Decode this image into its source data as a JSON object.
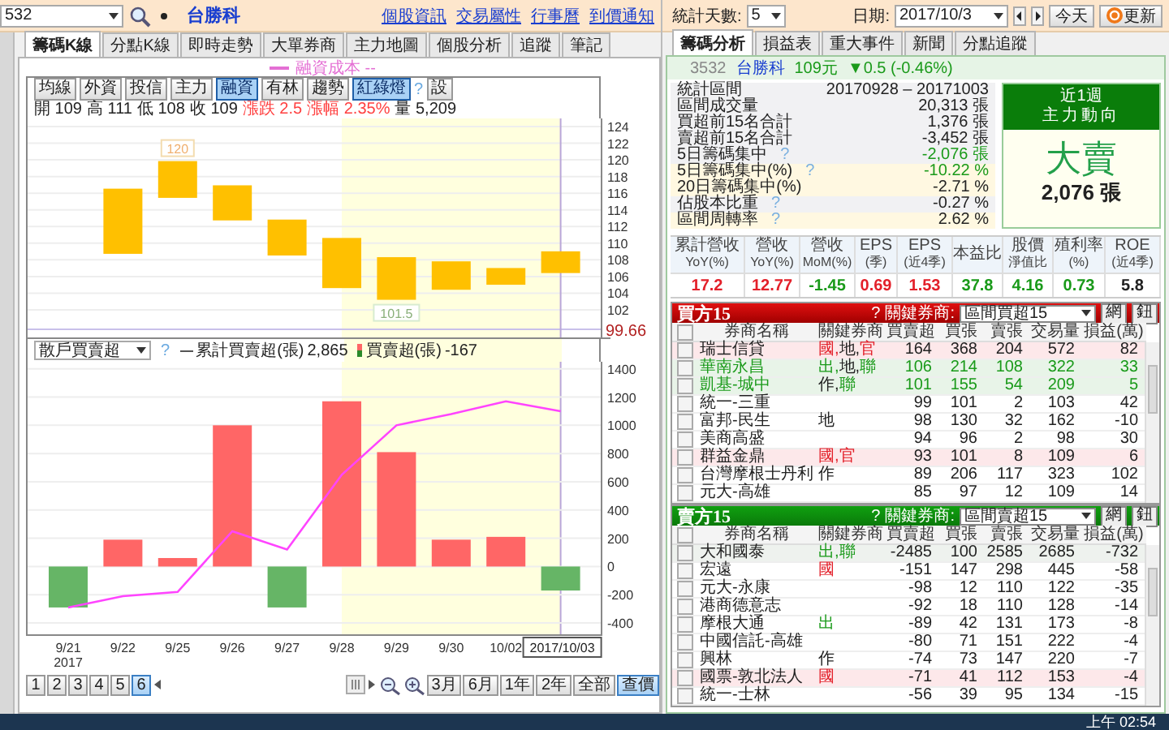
{
  "stock_bar": {
    "code": "532",
    "name": "台勝科",
    "links": [
      "個股資訊",
      "交易屬性",
      "行事曆",
      "到價通知"
    ]
  },
  "left_tabs": [
    {
      "label": "籌碼K線",
      "selected": true
    },
    {
      "label": "分點K線",
      "selected": false
    },
    {
      "label": "即時走勢",
      "selected": false
    },
    {
      "label": "大單券商",
      "selected": false
    },
    {
      "label": "主力地圖",
      "selected": false
    },
    {
      "label": "個股分析",
      "selected": false
    },
    {
      "label": "追蹤",
      "selected": false
    },
    {
      "label": "筆記",
      "selected": false
    }
  ],
  "candle_chart": {
    "legend": "融資成本 --",
    "buttons": [
      {
        "label": "均線",
        "kind": "toggle",
        "selected": false
      },
      {
        "label": "外資",
        "kind": "toggle",
        "selected": false
      },
      {
        "label": "投信",
        "kind": "toggle",
        "selected": false
      },
      {
        "label": "主力",
        "kind": "toggle",
        "selected": false
      },
      {
        "label": "融資",
        "kind": "toggle",
        "selected": true
      },
      {
        "label": "有林",
        "kind": "toggle",
        "selected": false
      },
      {
        "label": "趨勢",
        "kind": "toggle",
        "selected": false
      },
      {
        "label": "紅綠燈",
        "kind": "toggle",
        "selected": true
      },
      {
        "label": "?",
        "kind": "help"
      },
      {
        "label": "設",
        "kind": "toggle",
        "selected": false
      }
    ],
    "quote": [
      {
        "label": "開",
        "value": "109",
        "kind": "plain"
      },
      {
        "label": "高",
        "value": "111",
        "kind": "plain"
      },
      {
        "label": "低",
        "value": "108",
        "kind": "plain"
      },
      {
        "label": "收",
        "value": "109",
        "kind": "plain"
      },
      {
        "label": "漲跌",
        "value": "2.5",
        "kind": "change"
      },
      {
        "label": "漲幅",
        "value": "2.35%",
        "kind": "change"
      },
      {
        "label": "量",
        "value": "5,209",
        "kind": "plain"
      }
    ],
    "price_ticks": [
      "124",
      "122",
      "120",
      "118",
      "116",
      "114",
      "112",
      "110",
      "108",
      "106",
      "104",
      "102"
    ],
    "reference_price": "99.66",
    "high_label": "120",
    "low_label": "101.5"
  },
  "flow_chart": {
    "indicator": "散戶買賣超",
    "help": "?",
    "legend": [
      {
        "kind": "line",
        "value": "2,865"
      },
      {
        "kind": "bars",
        "value": "-167"
      }
    ],
    "year_label": "2017",
    "chart_data": {
      "type": "bar",
      "categories": [
        "9/21",
        "9/22",
        "9/25",
        "9/26",
        "9/27",
        "9/28",
        "9/29",
        "9/30",
        "10/02",
        "2017/10/03"
      ],
      "series": [
        {
          "name": "累計買賣超(張)",
          "type": "line",
          "color": "#ff44ff",
          "values": [
            -290,
            -210,
            -180,
            250,
            120,
            650,
            1000,
            1080,
            1170,
            1100
          ]
        },
        {
          "name": "買賣超(張)",
          "color": "#ff6666",
          "values": [
            -290,
            190,
            60,
            1000,
            -290,
            1170,
            810,
            190,
            210,
            -170
          ],
          "colors": [
            "#66b566",
            "#ff6666",
            "#ff6666",
            "#ff6666",
            "#66b566",
            "#ff6666",
            "#ff6666",
            "#ff6666",
            "#ff6666",
            "#66b566"
          ]
        }
      ],
      "stacked": false,
      "grid": true,
      "ref_lines": [
        {
          "axis": "x",
          "value": "2017/10/03",
          "color": "#b9a6d9"
        }
      ],
      "ylim": [
        -480,
        1450
      ],
      "yticks": [
        -400,
        -200,
        0,
        200,
        400,
        600,
        800,
        1000,
        1200,
        1400
      ]
    }
  },
  "chart_footer": {
    "pages": [
      {
        "label": "1",
        "selected": false
      },
      {
        "label": "2",
        "selected": false
      },
      {
        "label": "3",
        "selected": false
      },
      {
        "label": "4",
        "selected": false
      },
      {
        "label": "5",
        "selected": false
      },
      {
        "label": "6",
        "selected": true
      }
    ],
    "ranges": [
      {
        "label": "3月",
        "selected": false
      },
      {
        "label": "6月",
        "selected": false
      },
      {
        "label": "1年",
        "selected": false
      },
      {
        "label": "2年",
        "selected": false
      },
      {
        "label": "全部",
        "selected": false
      },
      {
        "label": "查價",
        "selected": true
      }
    ]
  },
  "controls": {
    "days_label": "統計天數:",
    "days": "5",
    "date_label": "日期:",
    "date": "2017/10/3",
    "today": "今天",
    "refresh": "更新"
  },
  "right_tabs": [
    {
      "label": "籌碼分析",
      "selected": true
    },
    {
      "label": "損益表",
      "selected": false
    },
    {
      "label": "重大事件",
      "selected": false
    },
    {
      "label": "新聞",
      "selected": false
    },
    {
      "label": "分點追蹤",
      "selected": false
    }
  ],
  "quote_header": {
    "code": "3532",
    "name": "台勝科",
    "price": "109元",
    "change": "▼0.5 (-0.46%)"
  },
  "stats": [
    {
      "label": "統計區間",
      "value": "20170928 – 20171003",
      "kind": "plain"
    },
    {
      "label": "區間成交量",
      "value": "20,313 張",
      "kind": "plain"
    },
    {
      "label": "買超前15名合計",
      "value": "1,376 張",
      "kind": "plain"
    },
    {
      "label": "賣超前15名合計",
      "value": "-3,452 張",
      "kind": "plain"
    },
    {
      "label": "5日籌碼集中",
      "help": "?",
      "value": "-2,076 張",
      "kind": "down"
    },
    {
      "label": "5日籌碼集中(%)",
      "help": "?",
      "value": "-10.22 %",
      "kind": "down"
    },
    {
      "label": "20日籌碼集中(%)",
      "value": "-2.71 %",
      "kind": "plain"
    },
    {
      "label": "佔股本比重",
      "help": "?",
      "value": "-0.27 %",
      "kind": "plain"
    },
    {
      "label": "區間周轉率",
      "help": "?",
      "value": "2.62 %",
      "kind": "plain"
    }
  ],
  "trend_box": {
    "period": "近1週",
    "title": "主力動向",
    "verdict": "大賣",
    "amount": "2,076 張"
  },
  "metrics": [
    {
      "label": "累計營收",
      "sublabel": "YoY(%)",
      "value": "17.2",
      "color": "#e3202a"
    },
    {
      "label": "營收",
      "sublabel": "YoY(%)",
      "value": "12.77",
      "color": "#e3202a"
    },
    {
      "label": "營收",
      "sublabel": "MoM(%)",
      "value": "-1.45",
      "color": "#1a9a1a"
    },
    {
      "label": "EPS",
      "sublabel": "(季)",
      "value": "0.69",
      "color": "#e3202a"
    },
    {
      "label": "EPS",
      "sublabel": "(近4季)",
      "value": "1.53",
      "color": "#e3202a"
    },
    {
      "label": "本益比",
      "value": "37.8",
      "color": "#1a9a1a"
    },
    {
      "label": "股價",
      "sublabel": "淨值比",
      "value": "4.16",
      "color": "#1a9a1a"
    },
    {
      "label": "殖利率",
      "sublabel": "(%)",
      "value": "0.73",
      "color": "#1a9a1a"
    },
    {
      "label": "ROE",
      "sublabel": "(近4季)",
      "value": "5.8",
      "color": "#222222"
    }
  ],
  "tables": [
    {
      "kind": "buy",
      "title": "買方15",
      "help": "?",
      "filter_label": "關鍵券商:",
      "filter": "區間買超15",
      "buttons": [
        "網",
        "鈕"
      ],
      "all_checked": false,
      "columns": [
        "券商名稱",
        "關鍵券商",
        "買賣超",
        "買張",
        "賣張",
        "交易量",
        "損益(萬)"
      ],
      "rows": [
        {
          "checked": false,
          "kind": "red",
          "cells": [
            "瑞士信貸",
            [
              {
                "text": "國,",
                "color": "#e3202a"
              },
              {
                "text": "地,",
                "color": "#222222"
              },
              {
                "text": "官",
                "color": "#e3202a"
              }
            ],
            "164",
            "368",
            "204",
            "572",
            "82"
          ]
        },
        {
          "checked": false,
          "kind": "green",
          "cells": [
            "華南永昌",
            [
              {
                "text": "出,",
                "color": "#1a9a1a"
              },
              {
                "text": "地,",
                "color": "#222222"
              },
              {
                "text": "聯",
                "color": "#1a9a1a"
              }
            ],
            "106",
            "214",
            "108",
            "322",
            "33"
          ]
        },
        {
          "checked": false,
          "kind": "green",
          "cells": [
            "凱基-城中",
            [
              {
                "text": "作,",
                "color": "#222222"
              },
              {
                "text": "聯",
                "color": "#1a9a1a"
              }
            ],
            "101",
            "155",
            "54",
            "209",
            "5"
          ]
        },
        {
          "checked": false,
          "kind": "plain",
          "cells": [
            "統一-三重",
            [],
            "99",
            "101",
            "2",
            "103",
            "42"
          ]
        },
        {
          "checked": false,
          "kind": "plain",
          "cells": [
            "富邦-民生",
            [
              {
                "text": "地",
                "color": "#222222"
              }
            ],
            "98",
            "130",
            "32",
            "162",
            "-10"
          ]
        },
        {
          "checked": false,
          "kind": "plain",
          "cells": [
            "美商高盛",
            [],
            "94",
            "96",
            "2",
            "98",
            "30"
          ]
        },
        {
          "checked": false,
          "kind": "red",
          "cells": [
            "群益金鼎",
            [
              {
                "text": "國,",
                "color": "#e3202a"
              },
              {
                "text": "官",
                "color": "#e3202a"
              }
            ],
            "93",
            "101",
            "8",
            "109",
            "6"
          ]
        },
        {
          "checked": false,
          "kind": "plain",
          "cells": [
            "台灣摩根士丹利",
            [
              {
                "text": "作",
                "color": "#222222"
              }
            ],
            "89",
            "206",
            "117",
            "323",
            "102"
          ]
        },
        {
          "checked": false,
          "kind": "plain",
          "cells": [
            "元大-高雄",
            [],
            "85",
            "97",
            "12",
            "109",
            "14"
          ]
        }
      ]
    },
    {
      "kind": "sell",
      "title": "賣方15",
      "help": "?",
      "filter_label": "關鍵券商:",
      "filter": "區間賣超15",
      "buttons": [
        "網",
        "鈕"
      ],
      "all_checked": false,
      "columns": [
        "券商名稱",
        "關鍵券商",
        "買賣超",
        "買張",
        "賣張",
        "交易量",
        "損益(萬)"
      ],
      "rows": [
        {
          "checked": false,
          "kind": "grey",
          "cells": [
            "大和國泰",
            [
              {
                "text": "出,",
                "color": "#1a9a1a"
              },
              {
                "text": "聯",
                "color": "#1a9a1a"
              }
            ],
            "-2485",
            "100",
            "2585",
            "2685",
            "-732"
          ]
        },
        {
          "checked": false,
          "kind": "plain",
          "cells": [
            "宏遠",
            [
              {
                "text": "國",
                "color": "#e3202a"
              }
            ],
            "-151",
            "147",
            "298",
            "445",
            "-58"
          ]
        },
        {
          "checked": false,
          "kind": "plain",
          "cells": [
            "元大-永康",
            [],
            "-98",
            "12",
            "110",
            "122",
            "-35"
          ]
        },
        {
          "checked": false,
          "kind": "plain",
          "cells": [
            "港商德意志",
            [],
            "-92",
            "18",
            "110",
            "128",
            "-14"
          ]
        },
        {
          "checked": false,
          "kind": "plain",
          "cells": [
            "摩根大通",
            [
              {
                "text": "出",
                "color": "#1a9a1a"
              }
            ],
            "-89",
            "42",
            "131",
            "173",
            "-8"
          ]
        },
        {
          "checked": false,
          "kind": "plain",
          "cells": [
            "中國信託-高雄",
            [],
            "-80",
            "71",
            "151",
            "222",
            "-4"
          ]
        },
        {
          "checked": false,
          "kind": "plain",
          "cells": [
            "興林",
            [
              {
                "text": "作",
                "color": "#222222"
              }
            ],
            "-74",
            "73",
            "147",
            "220",
            "-7"
          ]
        },
        {
          "checked": false,
          "kind": "red",
          "cells": [
            "國票-敦北法人",
            [
              {
                "text": "國",
                "color": "#e3202a"
              }
            ],
            "-71",
            "41",
            "112",
            "153",
            "-4"
          ]
        },
        {
          "checked": false,
          "kind": "plain",
          "cells": [
            "統一-士林",
            [],
            "-56",
            "39",
            "95",
            "134",
            "-15"
          ]
        }
      ]
    }
  ],
  "taskbar": {
    "clock": "上午 02:54"
  }
}
